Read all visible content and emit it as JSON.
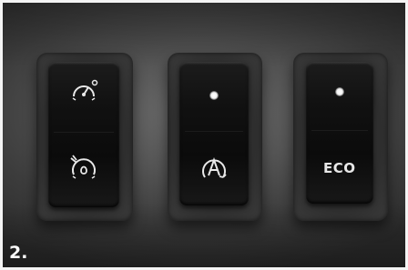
{
  "figure": {
    "number": "2."
  },
  "switches": [
    {
      "id": "left",
      "top_icon": "speed-limiter-icon",
      "bottom_icon": "cruise-control-icon",
      "led": false
    },
    {
      "id": "middle",
      "top_icon": "indicator-light",
      "bottom_icon": "stop-start-auto-icon",
      "led": true
    },
    {
      "id": "right",
      "top_icon": "indicator-light",
      "label": "ECO",
      "led": true
    }
  ],
  "colors": {
    "panel": "#5a5a5a",
    "switch_body": "#111111",
    "icon": "#e8e8e8",
    "border": "#f4f4f4"
  }
}
